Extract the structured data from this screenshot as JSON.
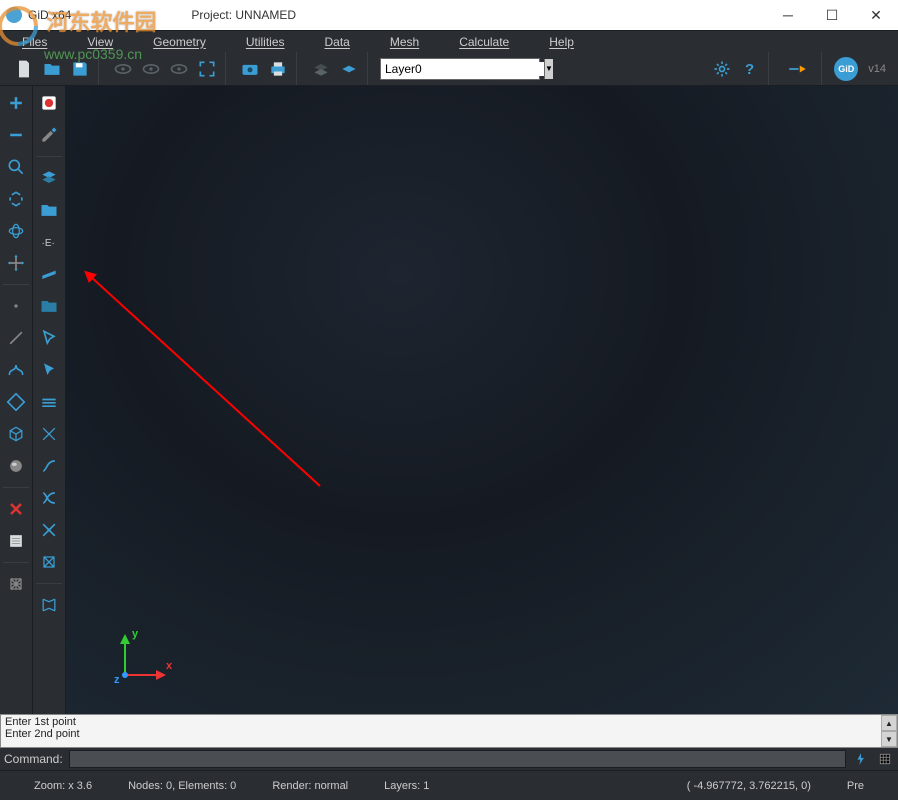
{
  "title": {
    "app": "GiD x64",
    "project": "Project: UNNAMED"
  },
  "menu": {
    "items": [
      "Files",
      "View",
      "Geometry",
      "Utilities",
      "Data",
      "Mesh",
      "Calculate",
      "Help"
    ]
  },
  "toolbar": {
    "layer_value": "Layer0",
    "version": "v14",
    "gid_label": "GiD"
  },
  "axis": {
    "x": "x",
    "y": "y",
    "z": "z"
  },
  "log": {
    "lines": [
      "Enter 1st point",
      "Enter 2nd point"
    ]
  },
  "command": {
    "label": "Command:",
    "value": ""
  },
  "status": {
    "zoom": "Zoom: x 3.6",
    "nodes": "Nodes: 0, Elements: 0",
    "render": "Render: normal",
    "layers": "Layers: 1",
    "coords": "( -4.967772, 3.762215, 0)",
    "mode": "Pre"
  },
  "watermark": {
    "line1": "河东软件园",
    "line2": "www.pc0359.cn"
  }
}
